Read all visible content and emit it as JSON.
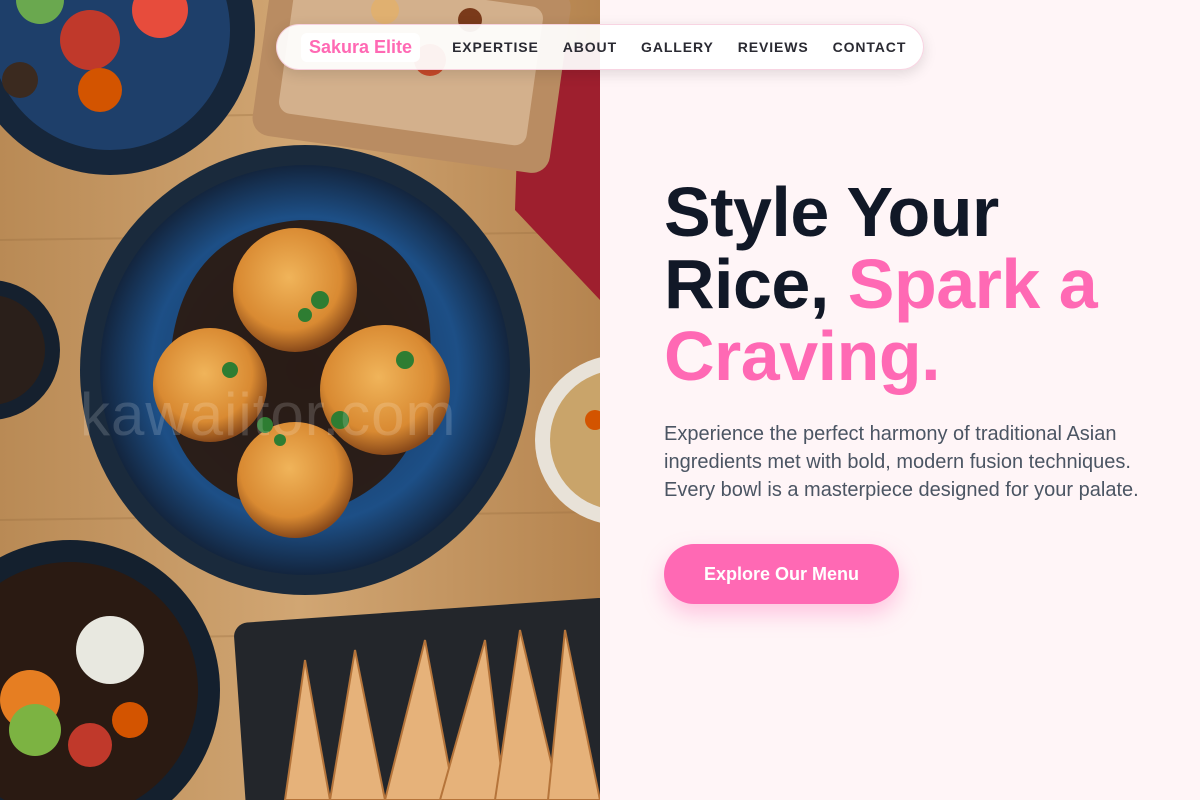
{
  "nav": {
    "brand": "Sakura Elite",
    "links": [
      "EXPERTISE",
      "ABOUT",
      "GALLERY",
      "REVIEWS",
      "CONTACT"
    ]
  },
  "hero": {
    "headline_part1": "Style Your Rice, ",
    "headline_accent": "Spark a Craving.",
    "subtitle": "Experience the perfect harmony of traditional Asian ingredients met with bold, modern fusion techniques. Every bowl is a masterpiece designed for your palate.",
    "cta_label": "Explore Our Menu"
  },
  "watermark": "kawaiitor.com",
  "colors": {
    "accent": "#ff69b4",
    "heading": "#111827",
    "body_text": "#4b5563",
    "panel_bg": "#fff5f7"
  },
  "image": {
    "subject": "food-spread-photo"
  }
}
